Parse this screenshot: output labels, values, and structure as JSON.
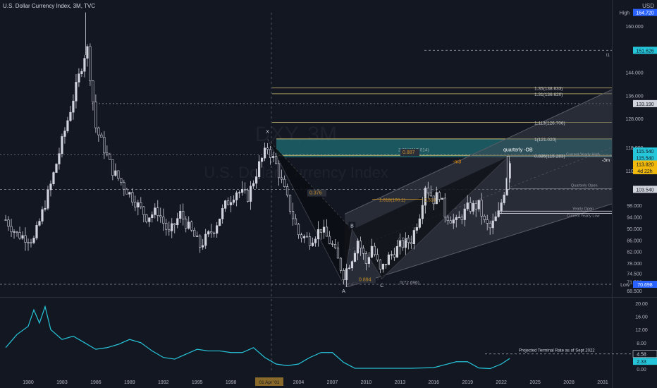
{
  "header": {
    "title": "U.S. Dollar Currency Index, 3M, TVC",
    "currency": "USD",
    "watermark_symbol": "DXY, 3M",
    "watermark_name": "U.S. Dollar Currency Index"
  },
  "colors": {
    "background": "#131722",
    "candle_body": "#d1d4dc",
    "indicator_line": "#26c6da",
    "zone": "#1f6e74",
    "fib": "#c8b870",
    "harmonic_fill": "#0b0d12",
    "channel": "#5a5d66"
  },
  "price_axis": {
    "labels": [
      "160.000",
      "144.000",
      "136.000",
      "128.000",
      "118.000",
      "110.000",
      "98.000",
      "94.000",
      "90.000",
      "86.000",
      "82.000",
      "78.000",
      "74.500",
      "71.500",
      "68.500"
    ],
    "tags": [
      {
        "label": "High",
        "value": "164.720"
      },
      {
        "label": "",
        "value": "151.626"
      },
      {
        "label": "",
        "value": "133.190"
      },
      {
        "label": "",
        "value": "115.540"
      },
      {
        "label": "",
        "value": "115.540"
      },
      {
        "label": "",
        "value": "113.820"
      },
      {
        "label": "",
        "value": "4d 22h"
      },
      {
        "label": "",
        "value": "103.540"
      },
      {
        "label": "Low",
        "value": "70.698"
      }
    ]
  },
  "indicator_axis": {
    "labels": [
      "20.00",
      "16.00",
      "12.00",
      "8.00",
      "4.00",
      "0.00"
    ],
    "tags": [
      "4.58",
      "2.33"
    ]
  },
  "time_axis": {
    "labels": [
      "1980",
      "1983",
      "1986",
      "1989",
      "1992",
      "1995",
      "1998",
      "2004",
      "2007",
      "2010",
      "2013",
      "2016",
      "2019",
      "2022",
      "2025",
      "2028",
      "2031"
    ],
    "cursor_label": "01 Apr '01"
  },
  "annotations": {
    "fib_levels": [
      "1.35(138.633)",
      "1.31(136.620)",
      "1.113(126.706)",
      "1(121.020)",
      "0.886(115.283)",
      "2.618(117.014)",
      "1.618(100.1)",
      "2.518",
      "0(72.696)",
      "0.887",
      "0.376",
      "0.894",
      "0.786(8"
    ],
    "pattern_points": [
      "X",
      "A",
      "B",
      "C"
    ],
    "zone_label": "quarterly -OB",
    "zone_tag": "-m3",
    "current_tag": "-3m",
    "t1": "t1",
    "level_labels": [
      "Current Yearly High",
      "Quarterly Open",
      "Yearly Open",
      "Current Yearly Low"
    ],
    "projection_label": "Projected Terminal  Rate as of Sept 2022"
  },
  "chart_data": [
    {
      "type": "candlestick",
      "title": "U.S. Dollar Currency Index, 3M, TVC",
      "ylim": [
        66,
        168
      ],
      "xlim": [
        1978.0,
        2032.5
      ],
      "x_ticks": [
        1980,
        1983,
        1986,
        1989,
        1992,
        1995,
        1998,
        2004,
        2007,
        2010,
        2013,
        2016,
        2019,
        2022,
        2025,
        2028,
        2031
      ],
      "key_points": {
        "x": [
          1978.0,
          1979.0,
          1980.5,
          1982.0,
          1983.0,
          1984.0,
          1985.0,
          1985.25,
          1986.0,
          1987.5,
          1989.0,
          1990.5,
          1991.5,
          1992.5,
          1993.5,
          1995.25,
          1996.5,
          1997.5,
          1998.5,
          1999.5,
          2000.5,
          2001.25,
          2002.0,
          2003.0,
          2004.0,
          2005.0,
          2006.0,
          2007.0,
          2008.0,
          2008.75,
          2009.25,
          2010.0,
          2010.5,
          2011.25,
          2012.0,
          2013.0,
          2014.0,
          2014.75,
          2015.25,
          2016.0,
          2016.5,
          2017.0,
          2018.0,
          2019.0,
          2020.0,
          2020.5,
          2021.0,
          2021.75,
          2022.25,
          2022.75
        ],
        "close": [
          93,
          88,
          86,
          105,
          120,
          135,
          150,
          152,
          125,
          110,
          102,
          94,
          96,
          88,
          95,
          84,
          90,
          98,
          103,
          101,
          112,
          118,
          112,
          100,
          88,
          86,
          90,
          84,
          74,
          80,
          86,
          78,
          84,
          75,
          80,
          84,
          86,
          95,
          105,
          100,
          102,
          95,
          92,
          97,
          98,
          92,
          90,
          95,
          103,
          113.82
        ]
      },
      "levels": {
        "all_time_high": 164.72,
        "low": 70.698,
        "current": 113.82,
        "quarterly_open": 103.54,
        "resistance": 115.54
      }
    },
    {
      "type": "line",
      "title": "",
      "ylim": [
        0,
        20
      ],
      "series": [
        {
          "values_x": [
            1978,
            1979,
            1980,
            1980.5,
            1981,
            1981.5,
            1982,
            1983,
            1984,
            1985,
            1986,
            1987,
            1988,
            1989,
            1990,
            1991,
            1992,
            1993,
            1994,
            1995,
            1996,
            1997,
            1998,
            1999,
            2000,
            2001,
            2002,
            2003,
            2004,
            2005,
            2006,
            2007,
            2008,
            2009,
            2010,
            2012,
            2014,
            2016,
            2017,
            2018,
            2019,
            2020,
            2021,
            2022,
            2022.75
          ],
          "values_y": [
            6.5,
            10.5,
            13,
            18,
            14,
            19,
            12,
            9,
            10,
            8,
            6,
            6.5,
            7.5,
            9,
            8,
            5.5,
            3.5,
            3,
            4.5,
            6,
            5.5,
            5.5,
            5,
            5,
            6.5,
            3.5,
            1.5,
            1,
            1.5,
            3.5,
            5,
            5,
            2,
            0.2,
            0.2,
            0.2,
            0.2,
            0.4,
            1.3,
            2.2,
            2.2,
            0.3,
            0.1,
            1.5,
            3.2
          ]
        }
      ],
      "reference": {
        "projected_terminal_rate": 4.58,
        "current": 2.33
      }
    }
  ]
}
